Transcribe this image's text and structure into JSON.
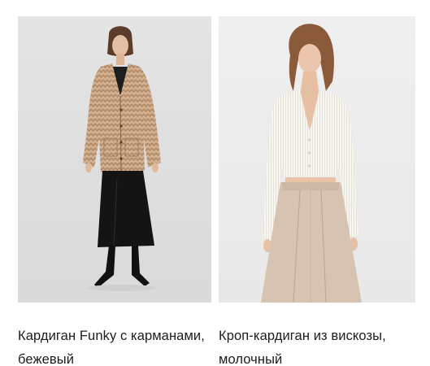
{
  "products": [
    {
      "title": "Кардиган Funky с карманами, бежевый",
      "image": "model-beige-knit-cardigan-black-skirt"
    },
    {
      "title": "Кроп-кардиган из вискозы, молочный",
      "image": "model-white-crop-cardigan-beige-trousers"
    }
  ]
}
